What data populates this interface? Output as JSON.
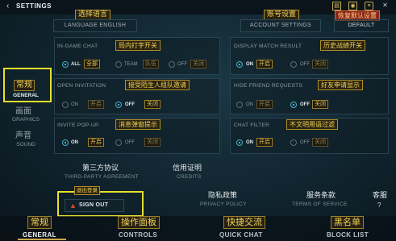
{
  "header": {
    "title": "SETTINGS",
    "back_icon": "‹"
  },
  "top": {
    "language_cn": "选择语言",
    "language_label": "LANGUAGE ENGLISH",
    "account_cn": "账号设置",
    "account_label": "ACCOUNT SETTINGS",
    "default_cn": "恢复默认设置",
    "default_label": "DEFAULT"
  },
  "sidebar": [
    {
      "label": "GENERAL",
      "cn": "常规"
    },
    {
      "label": "GRAPHICS",
      "cn": "画面"
    },
    {
      "label": "SOUND",
      "cn": "声音"
    }
  ],
  "ingame_chat": {
    "title": "IN-GAME CHAT",
    "cn": "局内打字开关",
    "options": [
      {
        "label": "ALL",
        "cn": "全部"
      },
      {
        "label": "TEAM",
        "cn": "队伍"
      },
      {
        "label": "OFF",
        "cn": "关闭"
      }
    ]
  },
  "display_match": {
    "title": "DISPLAY MATCH RESULT",
    "cn": "历史战绩开关",
    "on": "ON",
    "on_cn": "开启",
    "off": "OFF",
    "off_cn": "关闭"
  },
  "open_invitation": {
    "title": "OPEN INVITATION",
    "cn": "接受陌生人组队邀请",
    "on": "ON",
    "on_cn": "开启",
    "off": "OFF",
    "off_cn": "关闭"
  },
  "hide_friend": {
    "title": "HIDE FRIEND REQUESTS",
    "cn": "好友申请显示",
    "on": "ON",
    "on_cn": "开启",
    "off": "OFF",
    "off_cn": "关闭"
  },
  "invite_popup": {
    "title": "INVITE POP-UP",
    "cn": "消息弹窗提示",
    "on": "ON",
    "on_cn": "开启",
    "off": "OFF",
    "off_cn": "关闭"
  },
  "chat_filter": {
    "title": "CHAT FILTER",
    "cn": "不文明用语过滤",
    "on": "ON",
    "on_cn": "开启",
    "off": "OFF",
    "off_cn": "关闭"
  },
  "links": {
    "third_party_cn": "第三方协议",
    "third_party": "THIRD-PARTY AGREEMENT",
    "credits_cn": "信用证明",
    "credits": "CREDITS",
    "privacy_cn": "隐私政策",
    "privacy": "PRIVACY POLICY",
    "terms_cn": "服务条款",
    "terms": "TERMS OF SERVICE",
    "support_cn": "客服"
  },
  "signout": {
    "cn": "退出登录",
    "label": "SIGN OUT"
  },
  "nav": [
    {
      "label": "GENERAL",
      "cn": "常规"
    },
    {
      "label": "CONTROLS",
      "cn": "操作面板"
    },
    {
      "label": "QUICK CHAT",
      "cn": "快捷交流"
    },
    {
      "label": "BLOCK LIST",
      "cn": "黑名单"
    }
  ],
  "colors": {
    "accent": "#3fb2c8",
    "annotation": "#f2d25a",
    "highlight": "#e8df2a"
  }
}
